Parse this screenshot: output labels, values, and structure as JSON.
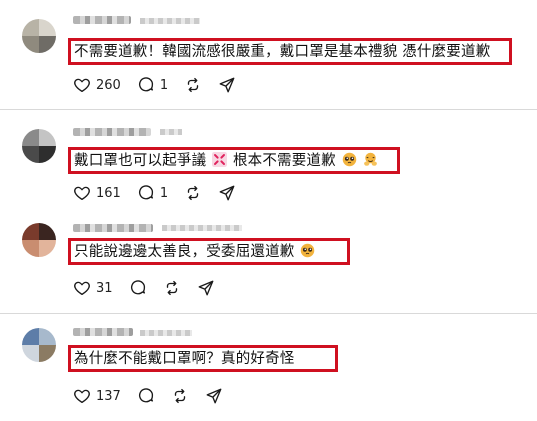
{
  "comments": [
    {
      "text": "不需要道歉！韓國流感很嚴重，戴口罩是基本禮貌 憑什麼要道歉",
      "likes": "260",
      "replies": "1",
      "avatar_colors": [
        "#b8b3a6",
        "#8f8a7e",
        "#d9d5cc",
        "#6f6c66"
      ]
    },
    {
      "text_parts": [
        "戴口罩也可以起爭議",
        "根本不需要道歉"
      ],
      "likes": "161",
      "replies": "1",
      "avatar_colors": [
        "#4a4a4a",
        "#8a8a8a",
        "#c4c4c4",
        "#2e2e2e"
      ]
    },
    {
      "text": "只能說邊邊太善良，受委屈還道歉",
      "likes": "31",
      "avatar_colors": [
        "#7a3b2c",
        "#c98d70",
        "#3a2520",
        "#e2b49b"
      ]
    },
    {
      "text": "為什麼不能戴口罩啊？真的好奇怪",
      "likes": "137",
      "avatar_colors": [
        "#5d7da8",
        "#a7b9cc",
        "#8b7b63",
        "#cfd6de"
      ]
    }
  ],
  "colors": {
    "highlight_border": "#cf1020",
    "divider": "#d9d9d9",
    "icon": "#1a1a1a"
  },
  "icons": [
    "heart-icon",
    "comment-icon",
    "repost-icon",
    "share-icon",
    "anger-symbol-emoji",
    "pleading-face-emoji",
    "hug-emoji"
  ]
}
